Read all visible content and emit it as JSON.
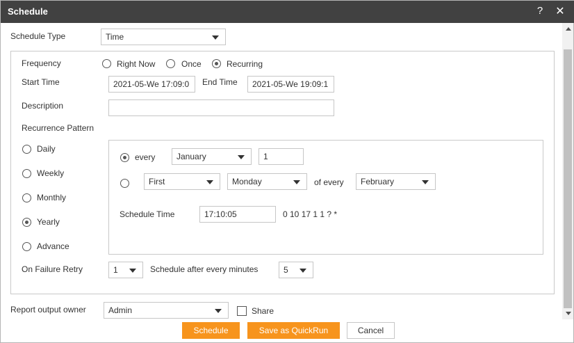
{
  "dialog": {
    "title": "Schedule",
    "help": "?",
    "close": "✕"
  },
  "schedule_type": {
    "label": "Schedule Type",
    "value": "Time"
  },
  "frequency": {
    "label": "Frequency",
    "options": [
      "Right Now",
      "Once",
      "Recurring"
    ],
    "selected": "Recurring"
  },
  "start_time": {
    "label": "Start Time",
    "value": "2021-05-We 17:09:0"
  },
  "end_time": {
    "label": "End Time",
    "value": "2021-05-We 19:09:1"
  },
  "description": {
    "label": "Description",
    "value": ""
  },
  "recurrence": {
    "label": "Recurrence Pattern",
    "options": [
      "Daily",
      "Weekly",
      "Monthly",
      "Yearly",
      "Advance"
    ],
    "selected": "Yearly"
  },
  "yearly": {
    "every_label": "every",
    "month": "January",
    "day": "1",
    "ordinal": "First",
    "weekday": "Monday",
    "of_every_label": "of every",
    "month2": "February",
    "schedule_time_label": "Schedule Time",
    "schedule_time": "17:10:05",
    "cron": "0 10 17 1 1 ? *"
  },
  "retry": {
    "label": "On Failure Retry",
    "count": "1",
    "after_label": "Schedule after every minutes",
    "minutes": "5"
  },
  "owner": {
    "label": "Report output owner",
    "value": "Admin",
    "share_label": "Share"
  },
  "buttons": {
    "schedule": "Schedule",
    "quickrun": "Save as QuickRun",
    "cancel": "Cancel"
  },
  "colors": {
    "titlebar": "#414141",
    "accent": "#f7941d"
  }
}
